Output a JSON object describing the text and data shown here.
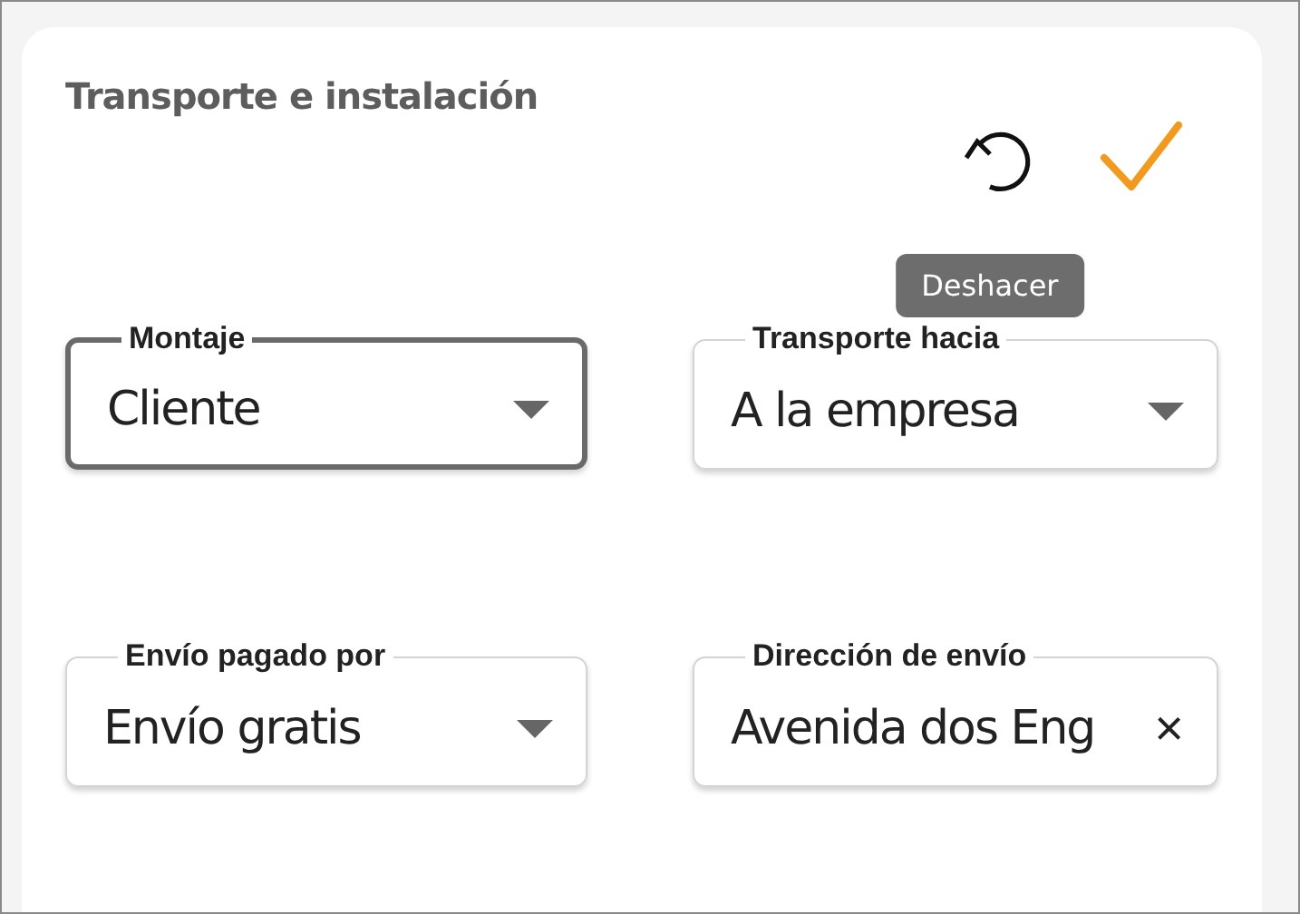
{
  "card": {
    "title": "Transporte e instalación",
    "actions": [
      {
        "kind": "undo",
        "tooltip": "Deshacer"
      },
      {
        "kind": "confirm"
      }
    ],
    "fields": [
      {
        "kind": "select",
        "label": "Montaje",
        "value": "Cliente",
        "focused": true
      },
      {
        "kind": "select",
        "label": "Transporte hacia",
        "value": "A la empresa",
        "focused": false
      },
      {
        "kind": "select",
        "label": "Envío pagado por",
        "value": "Envío gratis",
        "focused": false
      },
      {
        "kind": "clearable",
        "label": "Dirección de envío",
        "value": "Avenida dos Eng",
        "clear": "×",
        "focused": false
      }
    ]
  }
}
